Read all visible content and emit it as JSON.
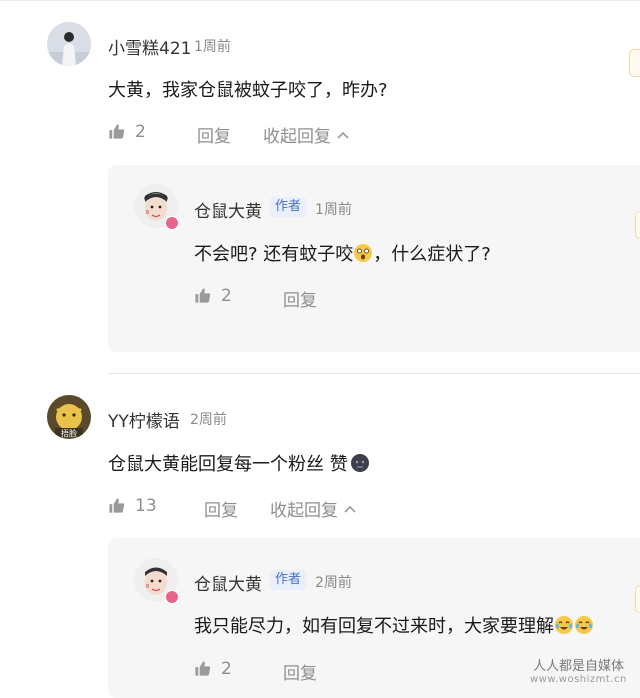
{
  "comments": [
    {
      "user": "小雪糕421",
      "time": "1周前",
      "text": "大黄，我家仓鼠被蚊子咬了，昨办?",
      "likes": "2",
      "reply_label": "回复",
      "collapse_label": "收起回复",
      "replies": [
        {
          "user": "仓鼠大黄",
          "badge": "作者",
          "time": "1周前",
          "text": "不会吧? 还有蚊子咬",
          "text_after_emoji": "，什么症状了?",
          "likes": "2",
          "reply_label": "回复"
        }
      ]
    },
    {
      "user": "YY柠檬语",
      "avatar_caption": "捂脸",
      "time": "2周前",
      "text": "仓鼠大黄能回复每一个粉丝 赞",
      "likes": "13",
      "reply_label": "回复",
      "collapse_label": "收起回复",
      "replies": [
        {
          "user": "仓鼠大黄",
          "badge": "作者",
          "time": "2周前",
          "text": "我只能尽力，如有回复不过来时，大家要理解",
          "likes": "2",
          "reply_label": "回复"
        }
      ]
    }
  ],
  "watermark": {
    "cn": "人人都是自媒体",
    "en": "www.woshizmt.cn"
  }
}
